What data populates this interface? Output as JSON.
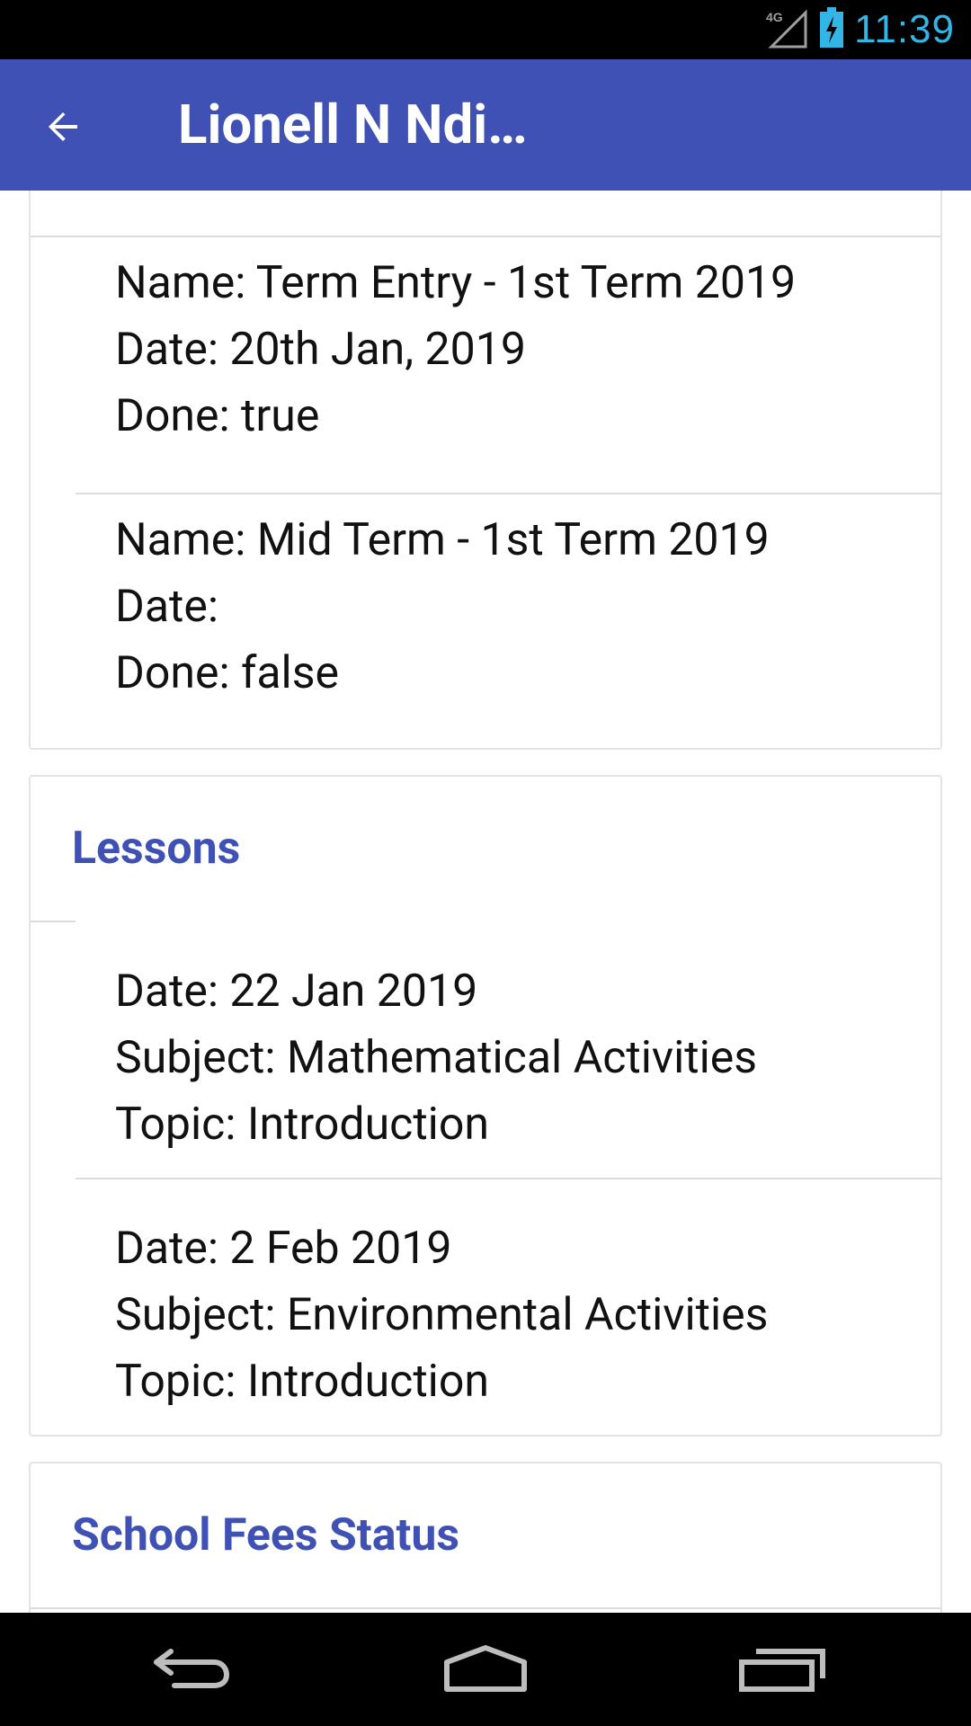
{
  "status_bar": {
    "network": "4G",
    "time": "11:39"
  },
  "app_bar": {
    "title": "Lionell N Ndi…",
    "back_icon": "arrow-back-icon"
  },
  "exams": [
    {
      "name": "Name: Term Entry - 1st Term 2019",
      "date": "Date: 20th Jan, 2019",
      "done": "Done: true"
    },
    {
      "name": "Name: Mid Term - 1st Term 2019",
      "date": "Date:",
      "done": "Done: false"
    }
  ],
  "lessons": {
    "title": "Lessons",
    "items": [
      {
        "date": "Date: 22 Jan 2019",
        "subject": "Subject: Mathematical Activities",
        "topic": "Topic: Introduction"
      },
      {
        "date": "Date: 2 Feb 2019",
        "subject": "Subject: Environmental Activities",
        "topic": "Topic: Introduction"
      }
    ]
  },
  "school_fees": {
    "title": "School Fees Status"
  },
  "nav_bar": {
    "icons": [
      "back-icon",
      "home-icon",
      "recents-icon"
    ]
  },
  "colors": {
    "primary": "#3f51b5",
    "status_clock": "#33b5e5"
  }
}
